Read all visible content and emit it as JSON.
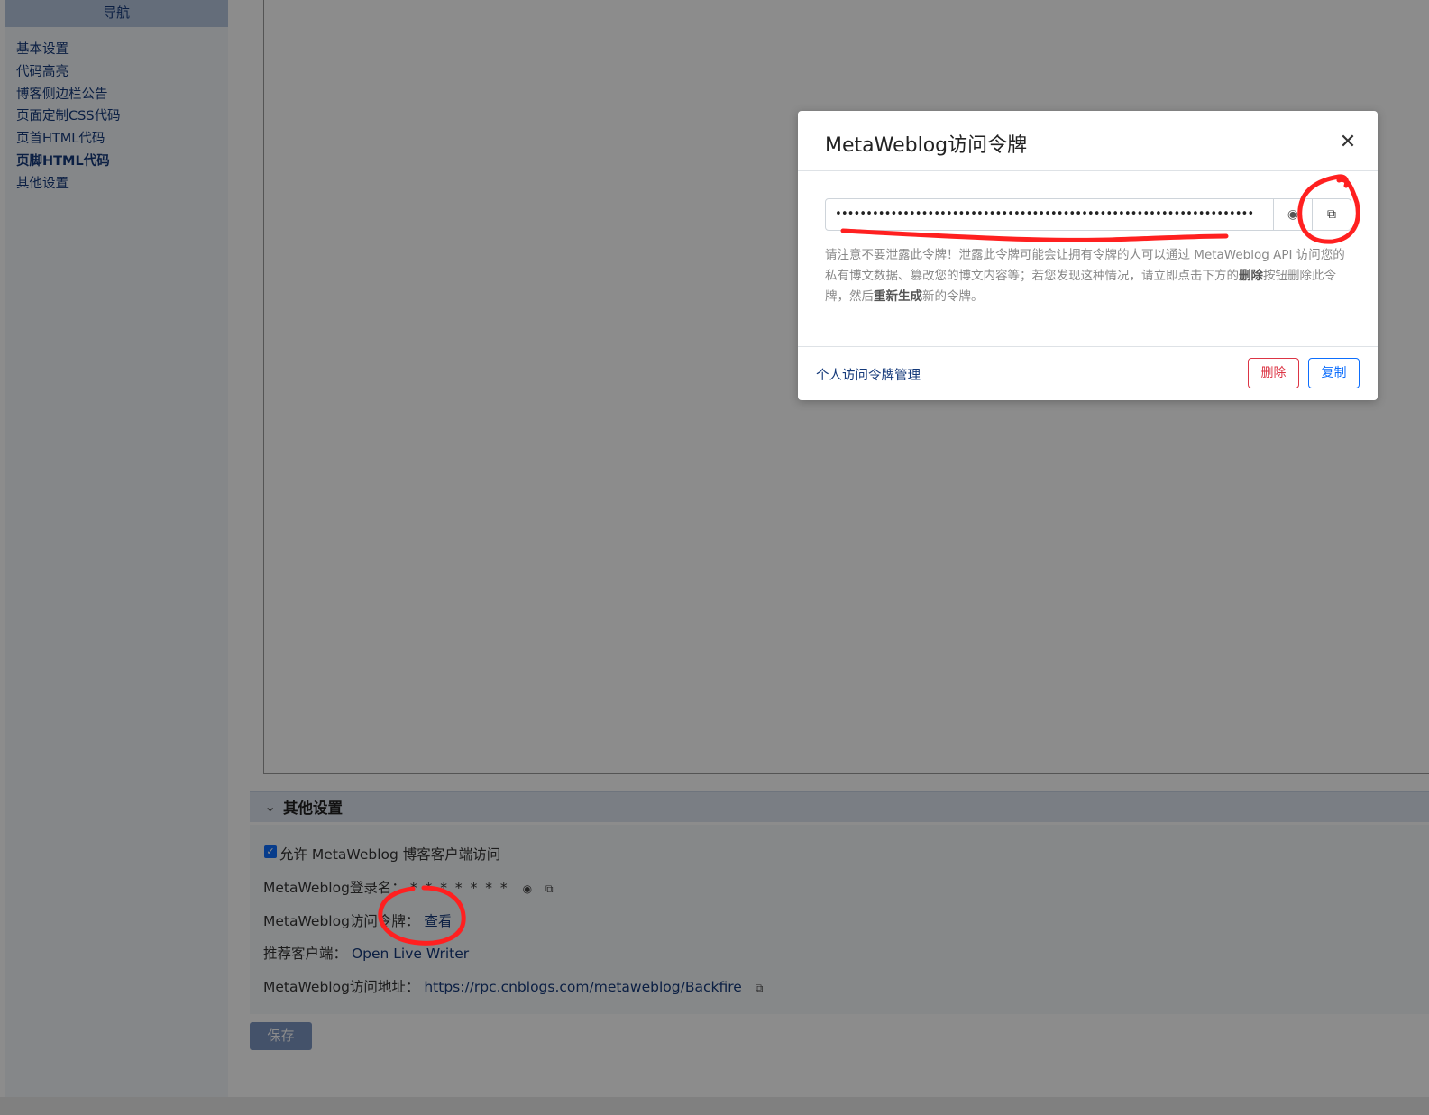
{
  "sidebar": {
    "header": "导航",
    "items": [
      {
        "label": "基本设置"
      },
      {
        "label": "代码高亮"
      },
      {
        "label": "博客侧边栏公告"
      },
      {
        "label": "页面定制CSS代码"
      },
      {
        "label": "页首HTML代码"
      },
      {
        "label": "页脚HTML代码"
      },
      {
        "label": "其他设置"
      }
    ]
  },
  "section": {
    "title": "其他设置",
    "allow_label": "允许 MetaWeblog 博客客户端访问",
    "login_label": "MetaWeblog登录名：",
    "login_value": "* * * * * * *",
    "token_label": "MetaWeblog访问令牌：",
    "token_view_link": "查看",
    "client_label": "推荐客户端：",
    "client_link": "Open Live Writer",
    "address_label": "MetaWeblog访问地址：",
    "address_link": "https://rpc.cnblogs.com/metaweblog/Backfire"
  },
  "save_button": "保存",
  "modal": {
    "title": "MetaWeblog访问令牌",
    "close_symbol": "✕",
    "token_value": "••••••••••••••••••••••••••••••••••••••••••••••••••••••••••••••••••••",
    "warning_pre": "请注意不要泄露此令牌！泄露此令牌可能会让拥有令牌的人可以通过 MetaWeblog API 访问您的私有博文数据、篡改您的博文内容等；若您发现这种情况，请立即点击下方的",
    "warning_bold1": "删除",
    "warning_mid": "按钮删除此令牌，然后",
    "warning_bold2": "重新生成",
    "warning_post": "新的令牌。",
    "manage_link": "个人访问令牌管理",
    "delete_button": "删除",
    "copy_button": "复制"
  },
  "icons": {
    "eye": "eye-icon",
    "copy": "copy-icon",
    "chevron": "double-chevron-down-icon",
    "check": "checkbox-check-icon"
  },
  "colors": {
    "link": "#14397a",
    "danger": "#dc3545",
    "primary": "#0d6efd",
    "annotation": "#ff2020"
  }
}
